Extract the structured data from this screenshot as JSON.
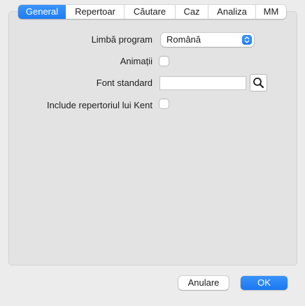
{
  "tabs": [
    {
      "label": "General",
      "active": true
    },
    {
      "label": "Repertoar",
      "active": false
    },
    {
      "label": "Căutare",
      "active": false
    },
    {
      "label": "Caz",
      "active": false
    },
    {
      "label": "Analiza",
      "active": false
    },
    {
      "label": "MM",
      "active": false
    }
  ],
  "form": {
    "language_label": "Limbă program",
    "language_value": "Română",
    "animations_label": "Animații",
    "animations_checked": false,
    "font_label": "Font standard",
    "font_value": "",
    "kent_label": "Include repertoriul lui Kent",
    "kent_checked": false
  },
  "buttons": {
    "cancel_label": "Anulare",
    "ok_label": "OK"
  },
  "colors": {
    "accent": "#1f7cf3",
    "window_bg": "#ececec",
    "panel_bg": "#e3e3e3"
  }
}
